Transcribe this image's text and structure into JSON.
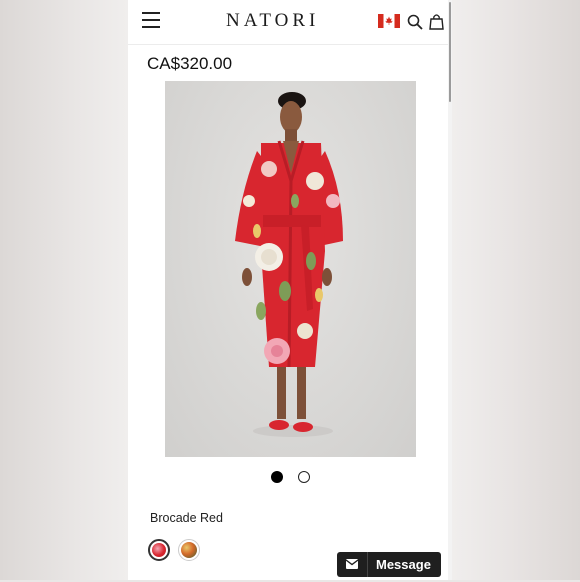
{
  "header": {
    "brand": "NATORI",
    "menu_icon": "hamburger-menu-icon",
    "flag_icon": "canada-flag-icon",
    "search_icon": "search-icon",
    "bag_icon": "shopping-bag-icon"
  },
  "product": {
    "price": "CA$320.00",
    "image_icon": "product-photo-red-floral-robe",
    "carousel": {
      "count": 2,
      "active": 1
    },
    "color_name": "Brocade Red",
    "swatches": [
      "brocade-red",
      "multicolor-print"
    ]
  },
  "chat": {
    "label": "Message",
    "icon": "envelope-icon"
  },
  "colors": {
    "robe": "#d8262f",
    "background": "#ffffff",
    "chat_bg": "#1f1f1f"
  }
}
